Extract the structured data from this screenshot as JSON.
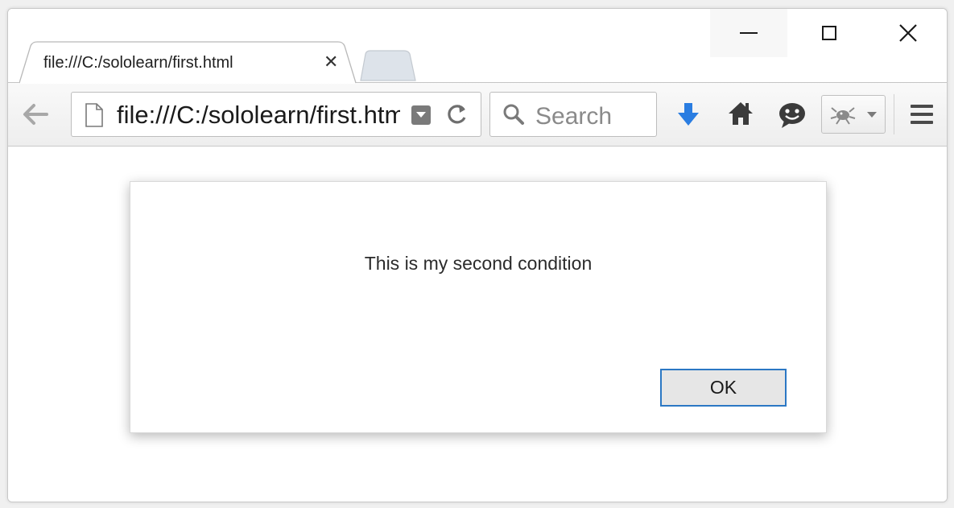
{
  "tab": {
    "title": "file:///C:/sololearn/first.html",
    "close_glyph": "✕"
  },
  "window_controls": {
    "close_glyph": "✕"
  },
  "toolbar": {
    "url": "file:///C:/sololearn/first.html",
    "search_placeholder": "Search",
    "icons": {
      "back": "back-arrow-icon",
      "page": "page-icon",
      "reader": "reader-dropdown-icon",
      "reload": "reload-icon",
      "search": "search-icon",
      "download": "download-arrow-icon",
      "home": "home-icon",
      "chat": "chat-smiley-icon",
      "addon": "bug-addon-icon",
      "menu": "hamburger-menu-icon"
    },
    "colors": {
      "download_blue": "#2a7de1",
      "ok_border": "#2b78c4"
    }
  },
  "dialog": {
    "message": "This is my second condition",
    "ok_label": "OK"
  }
}
